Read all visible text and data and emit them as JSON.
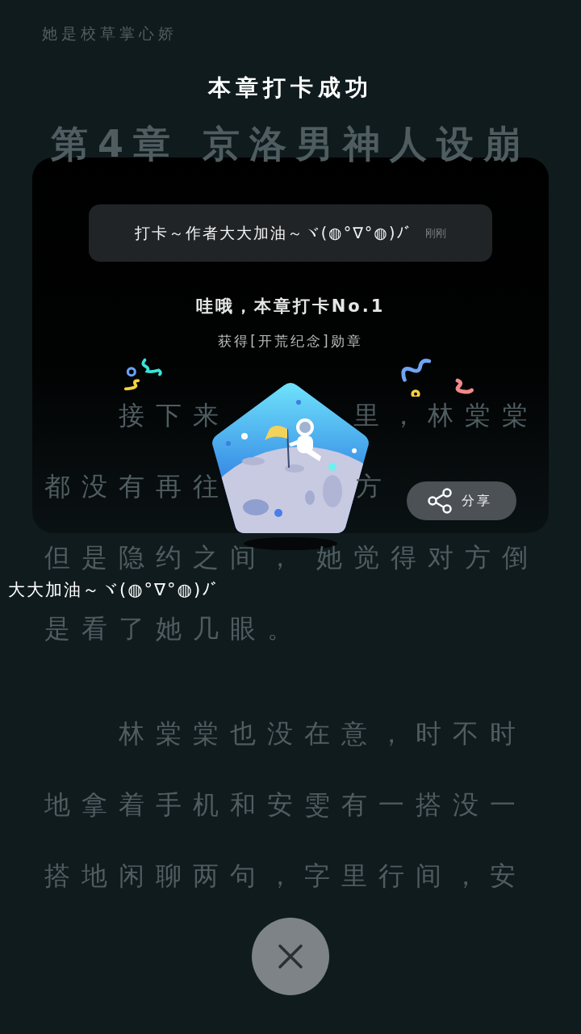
{
  "reader": {
    "book_title": "她是校草掌心娇",
    "chapter_title": "第4章 京洛男神人设崩",
    "paragraphs": [
      {
        "lines": [
          {
            "segments": [
              "接下来",
              "里，林棠棠"
            ]
          },
          {
            "segments": [
              "都没有再往",
              "方"
            ]
          },
          {
            "segments": [
              "但是隐约之间，",
              "她觉得对方倒"
            ]
          },
          {
            "segments": [
              "是看了她几眼。"
            ]
          }
        ]
      },
      {
        "lines": [
          {
            "segments": [
              "林棠棠也没在意，时不时"
            ]
          },
          {
            "segments": [
              "地拿着手机和安雯有一搭没一"
            ]
          },
          {
            "segments": [
              "搭地闲聊两句，字里行间，安"
            ]
          }
        ]
      }
    ]
  },
  "danmaku": "大大加油～ヾ(◍°∇°◍)ﾉﾞ",
  "dialog": {
    "title": "本章打卡成功",
    "comment": {
      "text": "打卡～作者大大加油～ヾ(◍°∇°◍)ﾉﾞ",
      "time": "刚刚"
    },
    "achievement": "哇哦，本章打卡No.1",
    "reward": "获得[开荒纪念]勋章",
    "share_button": "分享"
  }
}
